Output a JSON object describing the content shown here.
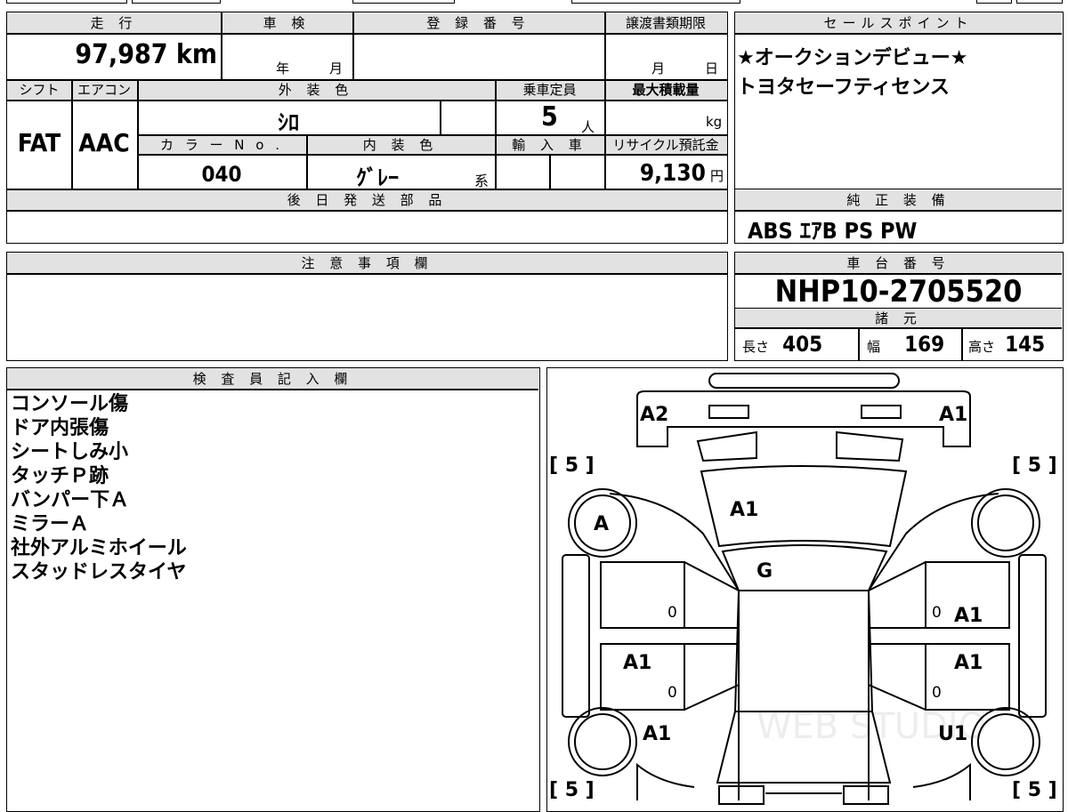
{
  "top": {
    "mileage_label": "走 行",
    "mileage_value": "97,987",
    "mileage_unit": "km",
    "inspection_label": "車 検",
    "inspection_year": "年",
    "inspection_month": "月",
    "registration_label": "登 録 番 号",
    "transfer_label": "譲渡書類期限",
    "transfer_month": "月",
    "transfer_day": "日"
  },
  "row2": {
    "shift_label": "シフト",
    "shift_value": "FAT",
    "ac_label": "エアコン",
    "ac_value": "AAC",
    "exterior_label": "外 装 色",
    "exterior_value": "ｼﾛ",
    "capacity_label": "乗車定員",
    "capacity_value": "5",
    "capacity_unit": "人",
    "load_label": "最大積載量",
    "load_unit": "kg",
    "color_no_label": "カ ラ ー N o .",
    "color_no_value": "040",
    "interior_label": "内 装 色",
    "interior_value": "ｸﾞﾚｰ",
    "interior_suffix": "系",
    "import_label": "輸 入 車",
    "recycle_label": "リサイクル預託金",
    "recycle_value": "9,130",
    "recycle_unit": "円"
  },
  "later_parts": {
    "label": "後 日 発 送 部 品"
  },
  "sales_point": {
    "label": "セールスポイント",
    "lines": [
      "★オークションデビュー★",
      "トヨタセーフティセンス"
    ]
  },
  "equipment": {
    "label": "純 正 装 備",
    "value": "ABS ｴｱB PS PW"
  },
  "notes": {
    "label": "注 意 事 項 欄"
  },
  "chassis": {
    "label": "車 台 番 号",
    "value": "NHP10-2705520"
  },
  "specs": {
    "label": "諸 元",
    "length_label": "長さ",
    "length_value": "405",
    "width_label": "幅",
    "width_value": "169",
    "height_label": "高さ",
    "height_value": "145"
  },
  "inspector": {
    "label": "検 査 員 記 入 欄",
    "lines": [
      "コンソール傷",
      "ドア内張傷",
      "シートしみ小",
      "タッチＰ跡",
      "バンパー下Ａ",
      "ミラーＡ",
      "社外アルミホイール",
      "スタッドレスタイヤ"
    ]
  },
  "diagram": {
    "tire_marks": [
      "[ 5 ]",
      "[ 5 ]",
      "[ 5 ]",
      "[ 5 ]"
    ],
    "marks": {
      "front_left": "A2",
      "front_right": "A1",
      "hood": "A1",
      "windshield": "G",
      "wheel_front_left": "A",
      "front_door_right": "A1",
      "rear_door_left": "A1",
      "rear_door_right": "A1",
      "rear_fender_left": "A1",
      "rear_fender_right": "U1",
      "zero": "0"
    },
    "watermark": "WEB STUDIO"
  }
}
